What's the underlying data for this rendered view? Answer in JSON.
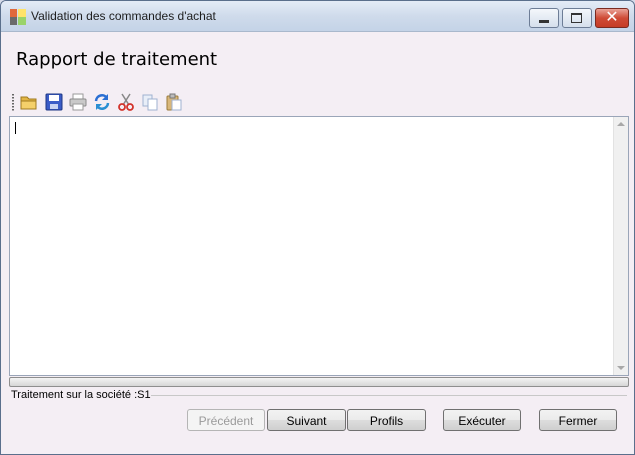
{
  "window": {
    "title": "Validation des commandes d'achat",
    "controls": {
      "minimize_icon": "minimize-icon",
      "maximize_icon": "maximize-icon",
      "close_icon": "close-icon",
      "close_glyph": "✕"
    }
  },
  "header": {
    "title": "Rapport de traitement"
  },
  "toolbar": {
    "icons": [
      "open-folder-icon",
      "save-icon",
      "print-icon",
      "refresh-icon",
      "cut-icon",
      "copy-icon",
      "paste-icon"
    ]
  },
  "editor": {
    "content": ""
  },
  "status": {
    "text": "Traitement sur la société :S1"
  },
  "buttons": {
    "previous": "Précédent",
    "next": "Suivant",
    "profiles": "Profils",
    "execute": "Exécuter",
    "close": "Fermer"
  },
  "colors": {
    "title_bar": "#cfdbeb",
    "close_button": "#c53b25",
    "window_bg": "#f4eef4"
  }
}
